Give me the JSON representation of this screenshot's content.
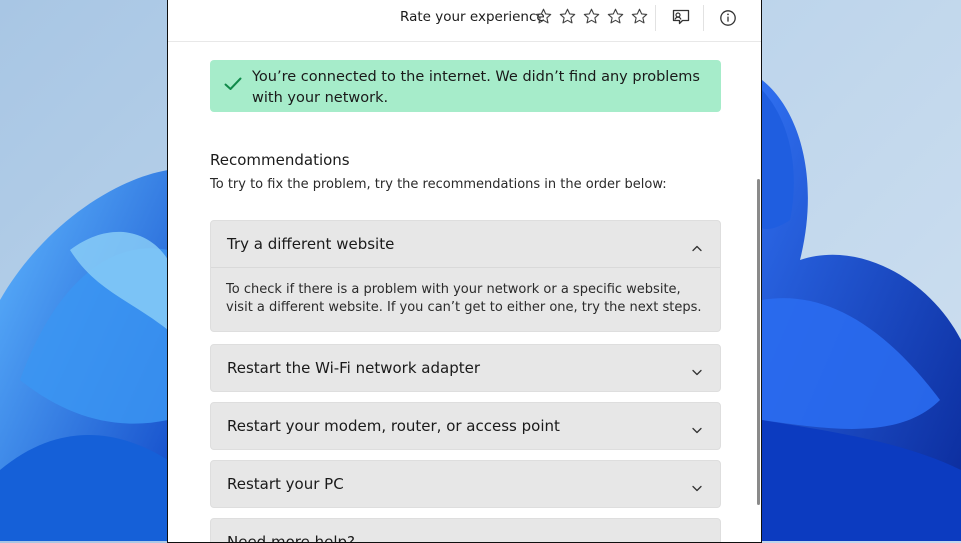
{
  "colors": {
    "banner_bg": "#a6ecca",
    "check": "#108a4a",
    "accordion_bg": "#e7e7e7"
  },
  "topbar": {
    "rate_label": "Rate your experience",
    "star_count": 5,
    "feedback_icon": "feedback-icon",
    "info_icon": "info-icon"
  },
  "banner": {
    "icon": "checkmark-icon",
    "text": "You’re connected to the internet. We didn’t find any problems with your network."
  },
  "recommendations": {
    "title": "Recommendations",
    "subtitle": "To try to fix the problem, try the recommendations in the order below:",
    "items": [
      {
        "label": "Try a different website",
        "expanded": true,
        "body": "To check if there is a problem with your network or a specific website, visit a different website. If you can’t get to either one, try the next steps."
      },
      {
        "label": "Restart the Wi-Fi network adapter",
        "expanded": false
      },
      {
        "label": "Restart your modem, router, or access point",
        "expanded": false
      },
      {
        "label": "Restart your PC",
        "expanded": false
      },
      {
        "label": "Need more help?",
        "expanded": false
      }
    ]
  }
}
